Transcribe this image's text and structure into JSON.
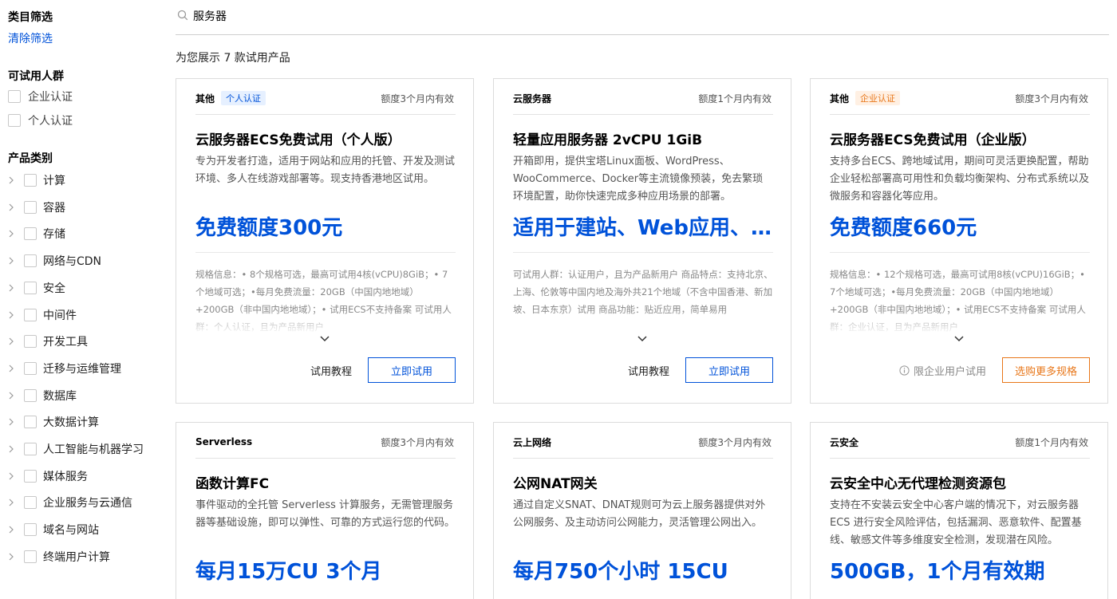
{
  "sidebar": {
    "filter_title": "类目筛选",
    "clear_filter": "清除筛选",
    "audience_title": "可试用人群",
    "audience_options": [
      "企业认证",
      "个人认证"
    ],
    "category_title": "产品类别",
    "categories": [
      "计算",
      "容器",
      "存储",
      "网络与CDN",
      "安全",
      "中间件",
      "开发工具",
      "迁移与运维管理",
      "数据库",
      "大数据计算",
      "人工智能与机器学习",
      "媒体服务",
      "企业服务与云通信",
      "域名与网站",
      "终端用户计算"
    ]
  },
  "search": {
    "value": "服务器",
    "icon": "search-icon"
  },
  "result_count": "为您展示 7 款试用产品",
  "cards": [
    {
      "category": "其他",
      "badge": "个人认证",
      "badge_color": "#0052d9",
      "validity": "额度3个月内有效",
      "title": "云服务器ECS免费试用（个人版）",
      "desc": "专为开发者打造，适用于网站和应用的托管、开发及测试环境、多人在线游戏部署等。现支持香港地区试用。",
      "highlight": "免费额度300元",
      "spec": "规格信息：• 8个规格可选，最高可试用4核(vCPU)8GiB；• 7个地域可选；•每月免费流量：20GB（中国内地地域）+200GB（非中国内地地域）；• 试用ECS不支持备案 可试用人群：个人认证，且为产品新用户",
      "tutorial": "试用教程",
      "button": "立即试用"
    },
    {
      "category": "云服务器",
      "badge": "",
      "validity": "额度1个月内有效",
      "title": "轻量应用服务器 2vCPU 1GiB",
      "desc": "开箱即用，提供宝塔Linux面板、WordPress、WooCommerce、Docker等主流镜像预装，免去繁琐环境配置，助你快速完成多种应用场景的部署。",
      "highlight": "适用于建站、Web应用、电商独立站",
      "spec": "可试用人群：认证用户，且为产品新用户 商品特点：支持北京、上海、伦敦等中国内地及海外共21个地域（不含中国香港、新加坡、日本东京）试用 商品功能：贴近应用，简单易用",
      "tutorial": "试用教程",
      "button": "立即试用"
    },
    {
      "category": "其他",
      "badge": "企业认证",
      "badge_color": "#e8771a",
      "validity": "额度3个月内有效",
      "title": "云服务器ECS免费试用（企业版）",
      "desc": "支持多台ECS、跨地域试用，期间可灵活更换配置，帮助企业轻松部署高可用性和负载均衡架构、分布式系统以及微服务和容器化等应用。",
      "highlight": "免费额度660元",
      "spec": "规格信息：• 12个规格可选，最高可试用8核(vCPU)16GiB；• 7个地域可选；•每月免费流量：20GB（中国内地地域）+200GB（非中国内地地域）；• 试用ECS不支持备案 可试用人群：企业认证，且为产品新用户",
      "limit": "限企业用户试用",
      "button": "选购更多规格"
    },
    {
      "category": "Serverless",
      "badge": "",
      "validity": "额度3个月内有效",
      "title": "函数计算FC",
      "desc": "事件驱动的全托管 Serverless 计算服务，无需管理服务器等基础设施，即可以弹性、可靠的方式运行您的代码。",
      "highlight": "每月15万CU 3个月"
    },
    {
      "category": "云上网络",
      "badge": "",
      "validity": "额度3个月内有效",
      "title": "公网NAT网关",
      "desc": "通过自定义SNAT、DNAT规则可为云上服务器提供对外公网服务、及主动访问公网能力，灵活管理公网出入。",
      "highlight": "每月750个小时 15CU"
    },
    {
      "category": "云安全",
      "badge": "",
      "validity": "额度1个月内有效",
      "title": "云安全中心无代理检测资源包",
      "desc": "支持在不安装云安全中心客户端的情况下，对云服务器 ECS 进行安全风险评估，包括漏洞、恶意软件、配置基线、敏感文件等多维度安全检测，发现潜在风险。",
      "highlight": "500GB，1个月有效期"
    }
  ]
}
